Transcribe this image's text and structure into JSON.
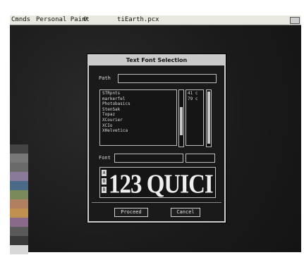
{
  "menubar": {
    "items": [
      "Cmnds",
      "Personal Paint",
      "0",
      "tiEarth.pcx"
    ]
  },
  "dialog": {
    "title": "Text Font Selection",
    "path_label": "Path",
    "path_value": "",
    "fonts": [
      "STRpnts",
      "markerfel",
      "Photobasics",
      "StenSak",
      "Topaz",
      "XCourier",
      "XCIo",
      "XHelvetica"
    ],
    "sizes": [
      "41 c",
      "79 c"
    ],
    "font_label": "Font",
    "font_value": "",
    "size_value": "",
    "preview_text": "123 QUICI",
    "preview_side": [
      "A",
      "B",
      "B"
    ],
    "proceed_label": "Proceed",
    "cancel_label": "Cancel"
  },
  "palette": {
    "colors": [
      "#444444",
      "#777777",
      "#6a6a6a",
      "#8a7a9a",
      "#4a6a8a",
      "#7a8a5a",
      "#b08060",
      "#c09050",
      "#8a6a8a",
      "#5a5a5a",
      "#3a3a3a",
      "#d8d8d8"
    ]
  }
}
